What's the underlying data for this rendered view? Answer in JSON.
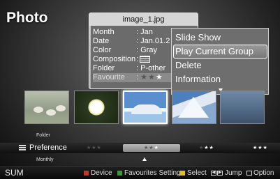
{
  "app": {
    "title": "Photo"
  },
  "info_panel": {
    "filename": "image_1.jpg",
    "rows": [
      {
        "key": "Month",
        "value": ": Jan"
      },
      {
        "key": "Date",
        "value": ": Jan.01.2"
      },
      {
        "key": "Color",
        "value": ": Gray"
      },
      {
        "key": "Composition",
        "value": ":"
      },
      {
        "key": "Folder",
        "value": ": P-other"
      },
      {
        "key": "Favourite",
        "value": ":"
      }
    ],
    "favourite_stars": {
      "empty": "★★",
      "filled": "★"
    }
  },
  "popup_menu": {
    "items": [
      "Slide Show",
      "Play Current Group",
      "Delete",
      "Information"
    ],
    "selected_index": 1
  },
  "thumbnails": [
    {
      "subject": "sheep-in-field"
    },
    {
      "subject": "white-flower"
    },
    {
      "subject": "snowy-landscape",
      "selected": true
    },
    {
      "subject": "snowy-mountain"
    },
    {
      "subject": "blue-scene"
    }
  ],
  "sort": {
    "prev": "Folder",
    "current": "Preference",
    "next": "Monthly",
    "ratings": [
      {
        "empty": "★★★",
        "filled": ""
      },
      {
        "empty": "★★",
        "filled": "★"
      },
      {
        "empty": "★",
        "filled": "★★"
      },
      {
        "empty": "",
        "filled": "★★★"
      }
    ],
    "selected_rating_index": 1
  },
  "bottom_bar": {
    "mode": "SUM",
    "hints": {
      "device": "Device",
      "favourites": "Favourites Setting",
      "select": "Select",
      "jump": "Jump",
      "option": "Option"
    },
    "colors": {
      "red": "#c0392b",
      "green": "#3a9a3a",
      "yellow": "#e0c020",
      "blue": "#2f6fd0"
    }
  }
}
